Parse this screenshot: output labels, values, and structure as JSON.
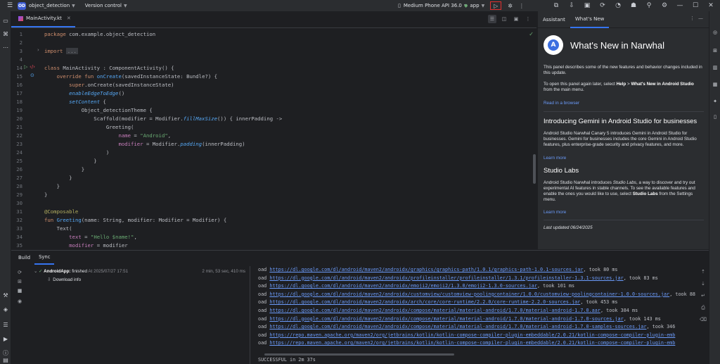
{
  "titlebar": {
    "project_badge": "OD",
    "project_name": "object_detection",
    "version_control": "Version control",
    "device": "Medium Phone API 36.0",
    "run_config": "app"
  },
  "editor": {
    "tab_label": "MainActivity.kt",
    "lines": [
      {
        "n": "1",
        "html": "<span class=\"kw\">package</span> com.example.object_detection"
      },
      {
        "n": "2",
        "html": ""
      },
      {
        "n": "3",
        "html": "<span class=\"kw\">import</span> <span class=\"gray\">...</span>"
      },
      {
        "n": "4",
        "html": ""
      },
      {
        "n": "14",
        "html": "<span class=\"kw\">class</span> MainActivity : ComponentActivity() {"
      },
      {
        "n": "15",
        "html": "    <span class=\"kw\">override fun</span> <span class=\"fn\">onCreate</span>(savedInstanceState: Bundle?) {"
      },
      {
        "n": "16",
        "html": "        <span class=\"kw\">super</span>.onCreate(savedInstanceState)"
      },
      {
        "n": "17",
        "html": "        <span class=\"it\">enableEdgeToEdge</span>()"
      },
      {
        "n": "18",
        "html": "        <span class=\"it\">setContent</span> {"
      },
      {
        "n": "19",
        "html": "            Object_detectionTheme {"
      },
      {
        "n": "20",
        "html": "                Scaffold(modifier = Modifier.<span class=\"it\">fillMaxSize</span>()) { innerPadding ->"
      },
      {
        "n": "21",
        "html": "                    Greeting("
      },
      {
        "n": "22",
        "html": "                        <span class=\"nm\">name</span> = <span class=\"str\">\"Android\"</span>,"
      },
      {
        "n": "23",
        "html": "                        <span class=\"nm\">modifier</span> = Modifier.<span class=\"it\">padding</span>(innerPadding)"
      },
      {
        "n": "24",
        "html": "                    )"
      },
      {
        "n": "25",
        "html": "                }"
      },
      {
        "n": "26",
        "html": "            }"
      },
      {
        "n": "27",
        "html": "        }"
      },
      {
        "n": "28",
        "html": "    }"
      },
      {
        "n": "29",
        "html": "}"
      },
      {
        "n": "30",
        "html": ""
      },
      {
        "n": "31",
        "html": "<span class=\"ann\">@Composable</span>"
      },
      {
        "n": "32",
        "html": "<span class=\"kw\">fun</span> <span class=\"fn\">Greeting</span>(name: String, modifier: Modifier = Modifier) {"
      },
      {
        "n": "33",
        "html": "    Text("
      },
      {
        "n": "34",
        "html": "        <span class=\"nm\">text</span> = <span class=\"str\">\"Hello $name!\"</span>,"
      },
      {
        "n": "35",
        "html": "        <span class=\"nm\">modifier</span> = modifier"
      },
      {
        "n": "36",
        "html": "    )"
      }
    ]
  },
  "right_panel": {
    "tabs": [
      "Assistant",
      "What's New"
    ],
    "title": "What's New in Narwhal",
    "intro": "This panel describes some of the new features and behavior changes included in this update.",
    "reopen_prefix": "To open this panel again later, select ",
    "reopen_help": "Help",
    "reopen_mid": " > ",
    "reopen_menu": "What's New in Android Studio",
    "reopen_suffix": " from the main menu.",
    "read_link": "Read in a browser",
    "section1_title": "Introducing Gemini in Android Studio for businesses",
    "section1_text": "Android Studio Narwhal Canary 5 introduces Gemini in Android Studio for businesses. Gemini for businesses includes the core Gemini in Android Studio features, plus enterprise-grade security and privacy features, and more.",
    "learn_more_1": "Learn more",
    "section2_title": "Studio Labs",
    "section2_prefix": "Android Studio Narwhal introduces ",
    "section2_em": "Studio Labs",
    "section2_mid": ", a way to discover and try out experimental AI features in stable channels. To see the available features and enable the ones you would like to use, select ",
    "section2_bold": "Studio Labs",
    "section2_suffix": " from the Settings menu.",
    "learn_more_2": "Learn more",
    "last_updated": "Last updated 06/24/2025"
  },
  "bottom": {
    "tabs": [
      "Build",
      "Sync"
    ],
    "tree_name": "AndroidApp:",
    "tree_status": " finished",
    "tree_at": " At 2025/07/27 17:51",
    "tree_time": "2 min, 53 sec, 410 ms",
    "tree_child": "Download info",
    "console": [
      {
        "pre": "oad ",
        "url": "https://dl.google.com/dl/android/maven2/androidx/graphics/graphics-path/1.0.1/graphics-path-1.0.1-sources.jar",
        "post": ", took 80 ms"
      },
      {
        "pre": "oad ",
        "url": "https://dl.google.com/dl/android/maven2/androidx/profileinstaller/profileinstaller/1.3.1/profileinstaller-1.3.1-sources.jar",
        "post": ", took 83 ms"
      },
      {
        "pre": "oad ",
        "url": "https://dl.google.com/dl/android/maven2/androidx/emoji2/emoji2/1.3.0/emoji2-1.3.0-sources.jar",
        "post": ", took 101 ms"
      },
      {
        "pre": "oad ",
        "url": "https://dl.google.com/dl/android/maven2/androidx/customview/customview-poolingcontainer/1.0.0/customview-poolingcontainer-1.0.0-sources.jar",
        "post": ", took 88 ms"
      },
      {
        "pre": "oad ",
        "url": "https://dl.google.com/dl/android/maven2/androidx/arch/core/core-runtime/2.2.0/core-runtime-2.2.0-sources.jar",
        "post": ", took 453 ms"
      },
      {
        "pre": "oad ",
        "url": "https://dl.google.com/dl/android/maven2/androidx/compose/material/material-android/1.7.0/material-android-1.7.0.aar",
        "post": ", took 384 ms"
      },
      {
        "pre": "oad ",
        "url": "https://dl.google.com/dl/android/maven2/androidx/compose/material/material-android/1.7.0/material-android-1.7.0-sources.jar",
        "post": ", took 143 ms"
      },
      {
        "pre": "oad ",
        "url": "https://dl.google.com/dl/android/maven2/androidx/compose/material/material-android/1.7.0/material-android-1.7.0-samples-sources.jar",
        "post": ", took 346"
      },
      {
        "pre": "oad ",
        "url": "https://repo.maven.apache.org/maven2/org/jetbrains/kotlin/kotlin-compose-compiler-plugin-embeddable/2.0.21/kotlin-compose-compiler-plugin-emb",
        "post": ""
      },
      {
        "pre": "oad ",
        "url": "https://repo.maven.apache.org/maven2/org/jetbrains/kotlin/kotlin-compose-compiler-plugin-embeddable/2.0.21/kotlin-compose-compiler-plugin-emb",
        "post": ""
      },
      {
        "pre": "",
        "url": "",
        "post": ""
      },
      {
        "pre": "SUCCESSFUL in 2m 37s",
        "url": "",
        "post": ""
      }
    ]
  }
}
